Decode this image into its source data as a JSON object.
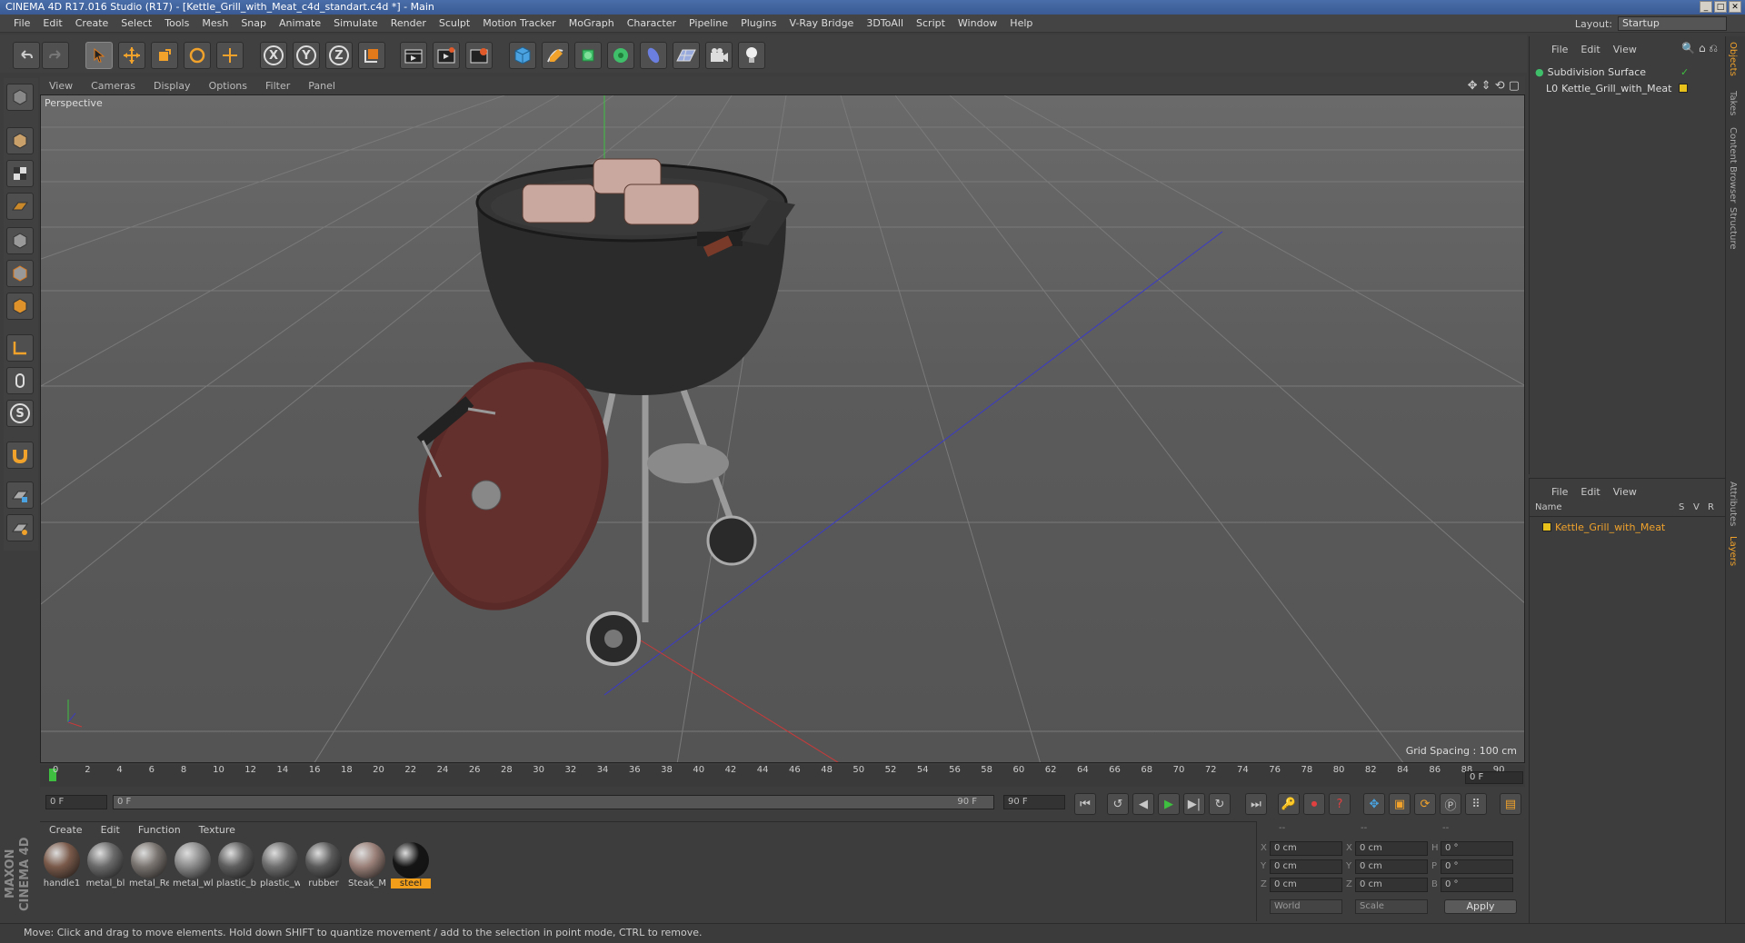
{
  "window": {
    "title": "CINEMA 4D R17.016 Studio (R17) - [Kettle_Grill_with_Meat_c4d_standart.c4d *] - Main"
  },
  "menu": [
    "File",
    "Edit",
    "Create",
    "Select",
    "Tools",
    "Mesh",
    "Snap",
    "Animate",
    "Simulate",
    "Render",
    "Sculpt",
    "Motion Tracker",
    "MoGraph",
    "Character",
    "Pipeline",
    "Plugins",
    "V-Ray Bridge",
    "3DToAll",
    "Script",
    "Window",
    "Help"
  ],
  "layout": {
    "label": "Layout:",
    "value": "Startup"
  },
  "toolbar": {
    "axis_x": "X",
    "axis_y": "Y",
    "axis_z": "Z"
  },
  "viewport": {
    "menu": [
      "View",
      "Cameras",
      "Display",
      "Options",
      "Filter",
      "Panel"
    ],
    "label": "Perspective",
    "grid_spacing": "Grid Spacing : 100 cm"
  },
  "timeline": {
    "ticks": [
      "0",
      "2",
      "4",
      "6",
      "8",
      "10",
      "12",
      "14",
      "16",
      "18",
      "20",
      "22",
      "24",
      "26",
      "28",
      "30",
      "32",
      "34",
      "36",
      "38",
      "40",
      "42",
      "44",
      "46",
      "48",
      "50",
      "52",
      "54",
      "56",
      "58",
      "60",
      "62",
      "64",
      "66",
      "68",
      "70",
      "72",
      "74",
      "76",
      "78",
      "80",
      "82",
      "84",
      "86",
      "88",
      "90"
    ],
    "current_frame": "0 F"
  },
  "playback": {
    "start": "0 F",
    "range_start": "0 F",
    "range_end": "90 F",
    "end": "90 F"
  },
  "materials": {
    "menu": [
      "Create",
      "Edit",
      "Function",
      "Texture"
    ],
    "items": [
      {
        "label": "handle1",
        "color": "#7a5a4a"
      },
      {
        "label": "metal_bl",
        "color": "#6a6a6a"
      },
      {
        "label": "metal_Re",
        "color": "#7a7470"
      },
      {
        "label": "metal_wl",
        "color": "#8a8a8a"
      },
      {
        "label": "plastic_b",
        "color": "#5e5e5e"
      },
      {
        "label": "plastic_w",
        "color": "#6e6e6e"
      },
      {
        "label": "rubber",
        "color": "#5a5a5a"
      },
      {
        "label": "Steak_M",
        "color": "#9a8078"
      },
      {
        "label": "steel",
        "color": "#151515"
      }
    ]
  },
  "coords": {
    "header": [
      "--",
      "--",
      "--"
    ],
    "rows": [
      {
        "a": "X",
        "av": "0 cm",
        "b": "X",
        "bv": "0 cm",
        "c": "H",
        "cv": "0 °"
      },
      {
        "a": "Y",
        "av": "0 cm",
        "b": "Y",
        "bv": "0 cm",
        "c": "P",
        "cv": "0 °"
      },
      {
        "a": "Z",
        "av": "0 cm",
        "b": "Z",
        "bv": "0 cm",
        "c": "B",
        "cv": "0 °"
      }
    ],
    "world": "World",
    "scale": "Scale",
    "apply": "Apply"
  },
  "object_manager": {
    "menu": [
      "File",
      "Edit",
      "View"
    ],
    "objects": [
      {
        "name": "Subdivision Surface",
        "indent": 0
      },
      {
        "name": "Kettle_Grill_with_Meat",
        "indent": 1
      }
    ]
  },
  "layer_manager": {
    "menu": [
      "File",
      "Edit",
      "View"
    ],
    "headers": {
      "name": "Name",
      "s": "S",
      "v": "V",
      "r": "R"
    },
    "layers": [
      {
        "name": "Kettle_Grill_with_Meat",
        "color": "#e8c21a"
      }
    ]
  },
  "right_tabs": [
    "Objects",
    "Takes",
    "Content Browser",
    "Structure",
    "Attributes",
    "Layers"
  ],
  "brand": "MAXON CINEMA 4D",
  "status": "Move: Click and drag to move elements. Hold down SHIFT to quantize movement / add to the selection in point mode, CTRL to remove."
}
